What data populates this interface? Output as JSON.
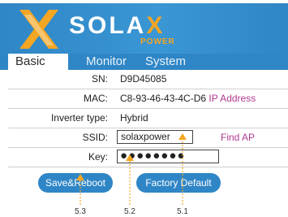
{
  "brand": {
    "name_main": "SOLA",
    "name_accent": "X",
    "sub": "POWER"
  },
  "tabs": [
    {
      "label": "Basic",
      "active": true
    },
    {
      "label": "Monitor",
      "active": false
    },
    {
      "label": "System",
      "active": false
    }
  ],
  "rows": {
    "sn": {
      "label": "SN:",
      "value": "D9D45085"
    },
    "mac": {
      "label": "MAC:",
      "value": "C8-93-46-43-4C-D6",
      "link": "IP Address"
    },
    "inverter": {
      "label": "Inverter type:",
      "value": "Hybrid"
    },
    "ssid": {
      "label": "SSID:",
      "value": "solaxpower",
      "link": "Find AP"
    },
    "key": {
      "label": "Key:",
      "value": "●●●●●●●●"
    }
  },
  "buttons": {
    "save": "Save&Reboot",
    "factory": "Factory Default"
  },
  "callouts": {
    "c1": "5.3",
    "c2": "5.2",
    "c3": "5.1"
  },
  "colors": {
    "header_blue": "#2f86c6",
    "accent_orange": "#f5a623",
    "link_magenta": "#b03a8e"
  }
}
